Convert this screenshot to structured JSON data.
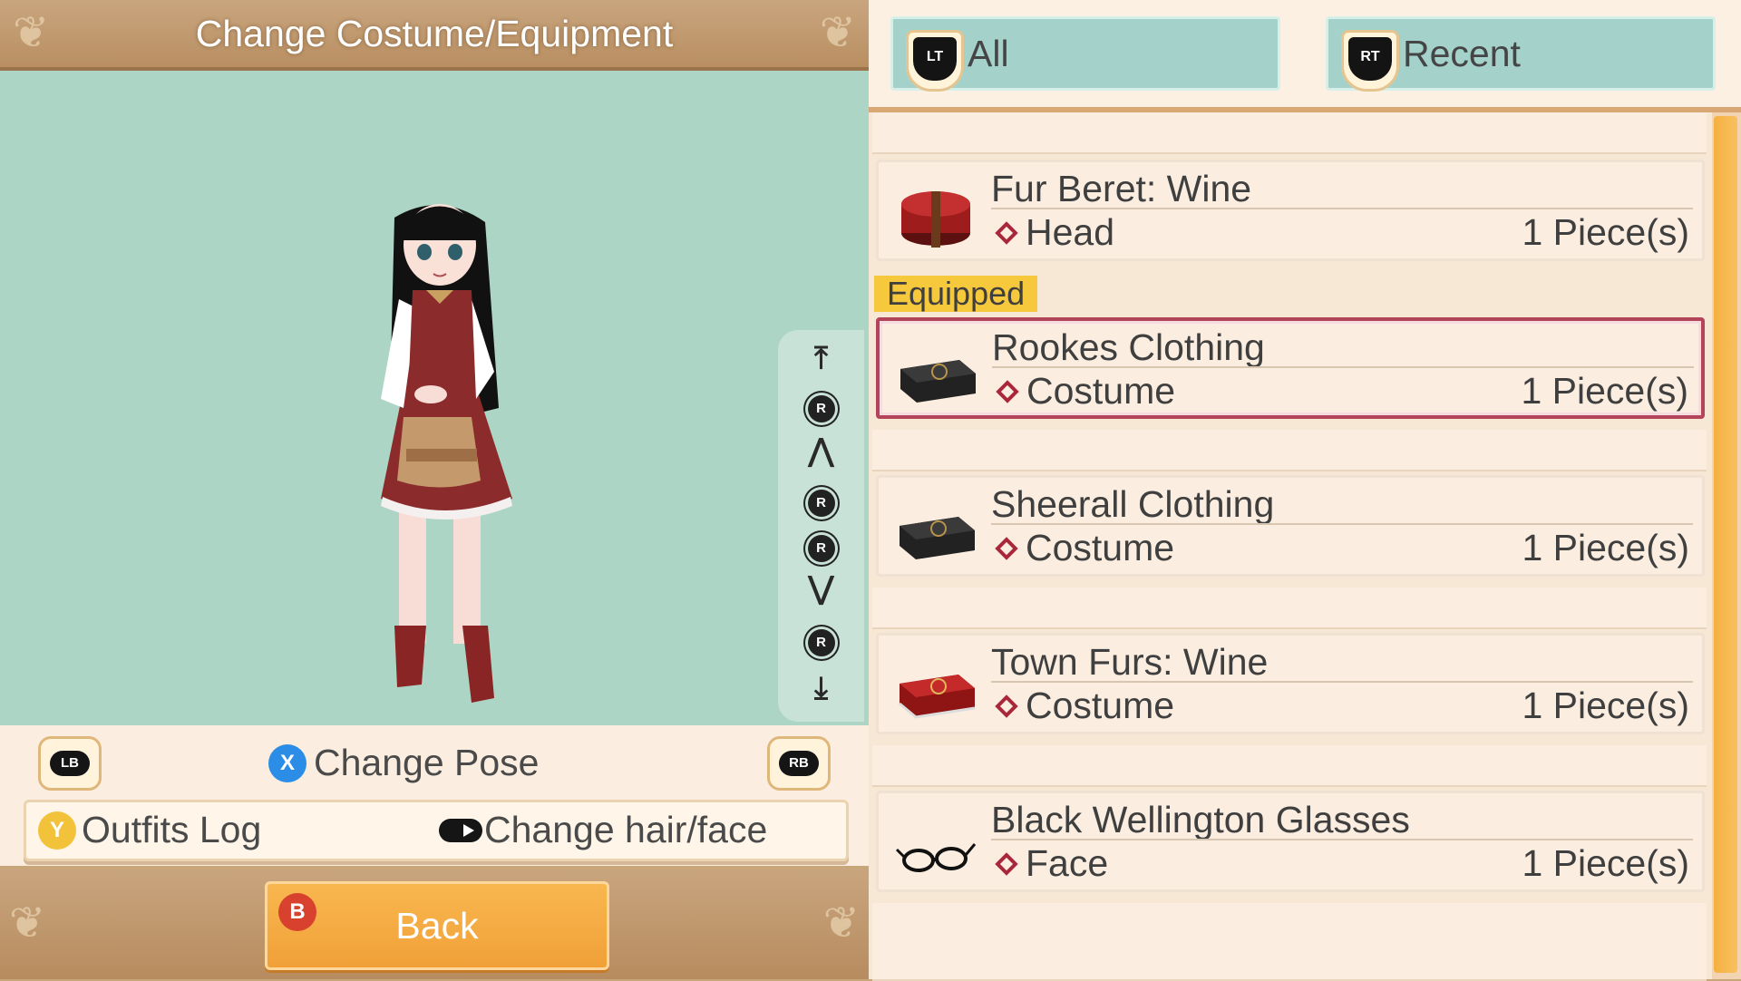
{
  "header": {
    "title": "Change Costume/Equipment"
  },
  "camera_controls": {
    "items": [
      {
        "name": "camera-top-icon",
        "glyph": "⤒"
      },
      {
        "name": "rstick-up-icon",
        "glyph": "R"
      },
      {
        "name": "camera-zoom-in-icon",
        "glyph": "⋀"
      },
      {
        "name": "rstick-left-icon",
        "glyph": "R"
      },
      {
        "name": "rstick-right-icon",
        "glyph": "R"
      },
      {
        "name": "camera-zoom-out-icon",
        "glyph": "⋁"
      },
      {
        "name": "rstick-down-icon",
        "glyph": "R"
      },
      {
        "name": "camera-bottom-icon",
        "glyph": "⤓"
      }
    ]
  },
  "controls": {
    "lb": "LB",
    "rb": "RB",
    "x_key": "X",
    "change_pose": "Change Pose",
    "y_key": "Y",
    "outfits_log": "Outfits Log",
    "change_hair_face": "Change hair/face",
    "b_key": "B",
    "back": "Back"
  },
  "tabs": [
    {
      "key": "LT",
      "label": "All"
    },
    {
      "key": "RT",
      "label": "Recent"
    }
  ],
  "equipped_badge": "Equipped",
  "items": [
    {
      "name": "Fur Beret: Wine",
      "category": "Head",
      "quantity": "1 Piece(s)",
      "icon": "hatbox-icon",
      "selected": false
    },
    {
      "name": "Rookes Clothing",
      "category": "Costume",
      "quantity": "1 Piece(s)",
      "icon": "costume-case-black-icon",
      "selected": true
    },
    {
      "name": "Sheerall Clothing",
      "category": "Costume",
      "quantity": "1 Piece(s)",
      "icon": "costume-case-black-icon",
      "selected": false
    },
    {
      "name": "Town Furs: Wine",
      "category": "Costume",
      "quantity": "1 Piece(s)",
      "icon": "costume-case-red-icon",
      "selected": false
    },
    {
      "name": "Black Wellington Glasses",
      "category": "Face",
      "quantity": "1 Piece(s)",
      "icon": "glasses-icon",
      "selected": false
    }
  ],
  "colors": {
    "accent_orange": "#f5a843",
    "tab_teal": "#a4d2cb",
    "selected_border": "#b3445a",
    "equipped_yellow": "#f6c93c"
  }
}
